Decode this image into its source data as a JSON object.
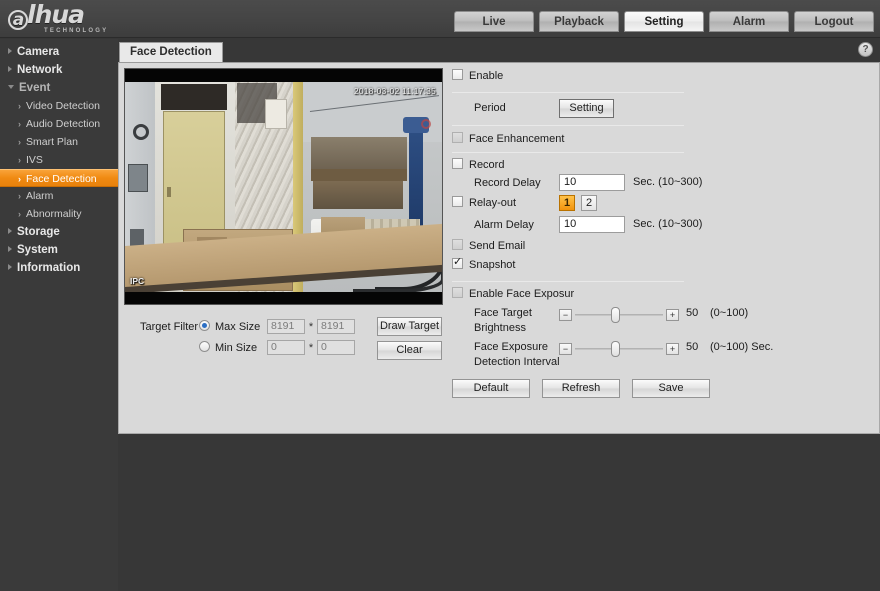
{
  "brand": {
    "logo_mark": "a",
    "logo_text": "lhua",
    "logo_tagline": "TECHNOLOGY"
  },
  "nav": {
    "tabs": [
      {
        "label": "Live",
        "active": false
      },
      {
        "label": "Playback",
        "active": false
      },
      {
        "label": "Setting",
        "active": true
      },
      {
        "label": "Alarm",
        "active": false
      },
      {
        "label": "Logout",
        "active": false
      }
    ]
  },
  "sidebar": {
    "items": [
      {
        "label": "Camera",
        "type": "group",
        "state": "collapsed"
      },
      {
        "label": "Network",
        "type": "group",
        "state": "collapsed"
      },
      {
        "label": "Event",
        "type": "group",
        "state": "expanded"
      },
      {
        "label": "Video Detection",
        "type": "sub",
        "selected": false
      },
      {
        "label": "Audio Detection",
        "type": "sub",
        "selected": false
      },
      {
        "label": "Smart Plan",
        "type": "sub",
        "selected": false
      },
      {
        "label": "IVS",
        "type": "sub",
        "selected": false
      },
      {
        "label": "Face Detection",
        "type": "sub",
        "selected": true
      },
      {
        "label": "Alarm",
        "type": "sub",
        "selected": false
      },
      {
        "label": "Abnormality",
        "type": "sub",
        "selected": false
      },
      {
        "label": "Storage",
        "type": "group",
        "state": "collapsed"
      },
      {
        "label": "System",
        "type": "group",
        "state": "collapsed"
      },
      {
        "label": "Information",
        "type": "group",
        "state": "collapsed"
      }
    ],
    "selected_color": "#f08a12"
  },
  "content": {
    "tab_label": "Face Detection",
    "help_glyph": "?"
  },
  "video": {
    "osd_time": "2018-03-02 11:17:35",
    "osd_channel": "IPC"
  },
  "target_filter": {
    "label": "Target Filter",
    "max_size": {
      "label": "Max Size",
      "selected": true,
      "width": "8191",
      "height": "8191"
    },
    "min_size": {
      "label": "Min Size",
      "selected": false,
      "width": "0",
      "height": "0"
    },
    "separator": "*",
    "draw_target_button": "Draw Target",
    "clear_button": "Clear"
  },
  "settings": {
    "enable": {
      "label": "Enable",
      "checked": false
    },
    "period": {
      "label": "Period",
      "button": "Setting"
    },
    "face_enhancement": {
      "label": "Face Enhancement",
      "checked": false,
      "disabled": true
    },
    "record": {
      "label": "Record",
      "checked": false
    },
    "record_delay": {
      "label": "Record Delay",
      "value": "10",
      "hint": "Sec. (10~300)"
    },
    "relay_out": {
      "label": "Relay-out",
      "checked": false,
      "channels": [
        {
          "label": "1",
          "active": true
        },
        {
          "label": "2",
          "active": false
        }
      ]
    },
    "alarm_delay": {
      "label": "Alarm Delay",
      "value": "10",
      "hint": "Sec. (10~300)"
    },
    "send_email": {
      "label": "Send Email",
      "checked": false,
      "disabled": true
    },
    "snapshot": {
      "label": "Snapshot",
      "checked": true
    },
    "enable_face_exposure": {
      "label": "Enable Face Exposur",
      "checked": false,
      "disabled": true
    },
    "face_target_brightness": {
      "label_line1": "Face Target",
      "label_line2": "Brightness",
      "value": "50",
      "range_hint": "(0~100)",
      "min": 0,
      "max": 100,
      "minus": "−",
      "plus": "+"
    },
    "face_exposure_interval": {
      "label_line1": "Face Exposure",
      "label_line2": "Detection Interval",
      "value": "50",
      "range_hint": "(0~100) Sec.",
      "min": 0,
      "max": 100,
      "minus": "−",
      "plus": "+"
    },
    "buttons": {
      "default": "Default",
      "refresh": "Refresh",
      "save": "Save"
    }
  }
}
